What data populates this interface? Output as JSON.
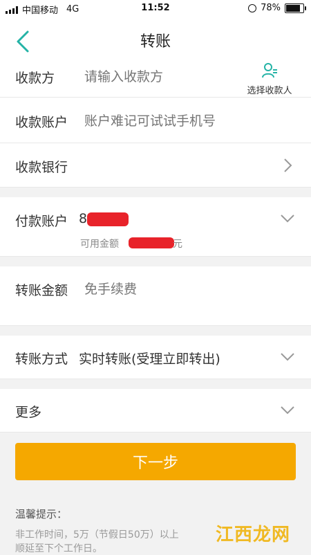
{
  "status_bar": {
    "carrier": "中国移动",
    "network": "4G",
    "time": "11:52",
    "battery": "78%"
  },
  "nav": {
    "title": "转账",
    "icon": "back-chevron"
  },
  "payee": {
    "label": "收款方",
    "placeholder": "请输入收款方",
    "select_label": "选择收款人"
  },
  "account": {
    "label": "收款账户",
    "placeholder": "账户难记可试试手机号"
  },
  "bank": {
    "label": "收款银行"
  },
  "pay_account": {
    "label": "付款账户",
    "number_prefix": "8",
    "available_label": "可用金额",
    "currency_unit": "元"
  },
  "amount": {
    "label": "转账金额",
    "placeholder": "免手续费"
  },
  "method": {
    "label": "转账方式",
    "value": "实时转账(受理立即转出)"
  },
  "more": {
    "label": "更多"
  },
  "actions": {
    "next_label": "下一步"
  },
  "tips": {
    "title": "温馨提示：",
    "line1": "非工作时间，5万（节假日50万）以上",
    "line2": "顺延至下个工作日。"
  },
  "watermark": {
    "text": "江西龙网"
  },
  "colors": {
    "accent": "#24b3a6",
    "button": "#f5a800",
    "redaction": "#e8232a"
  }
}
